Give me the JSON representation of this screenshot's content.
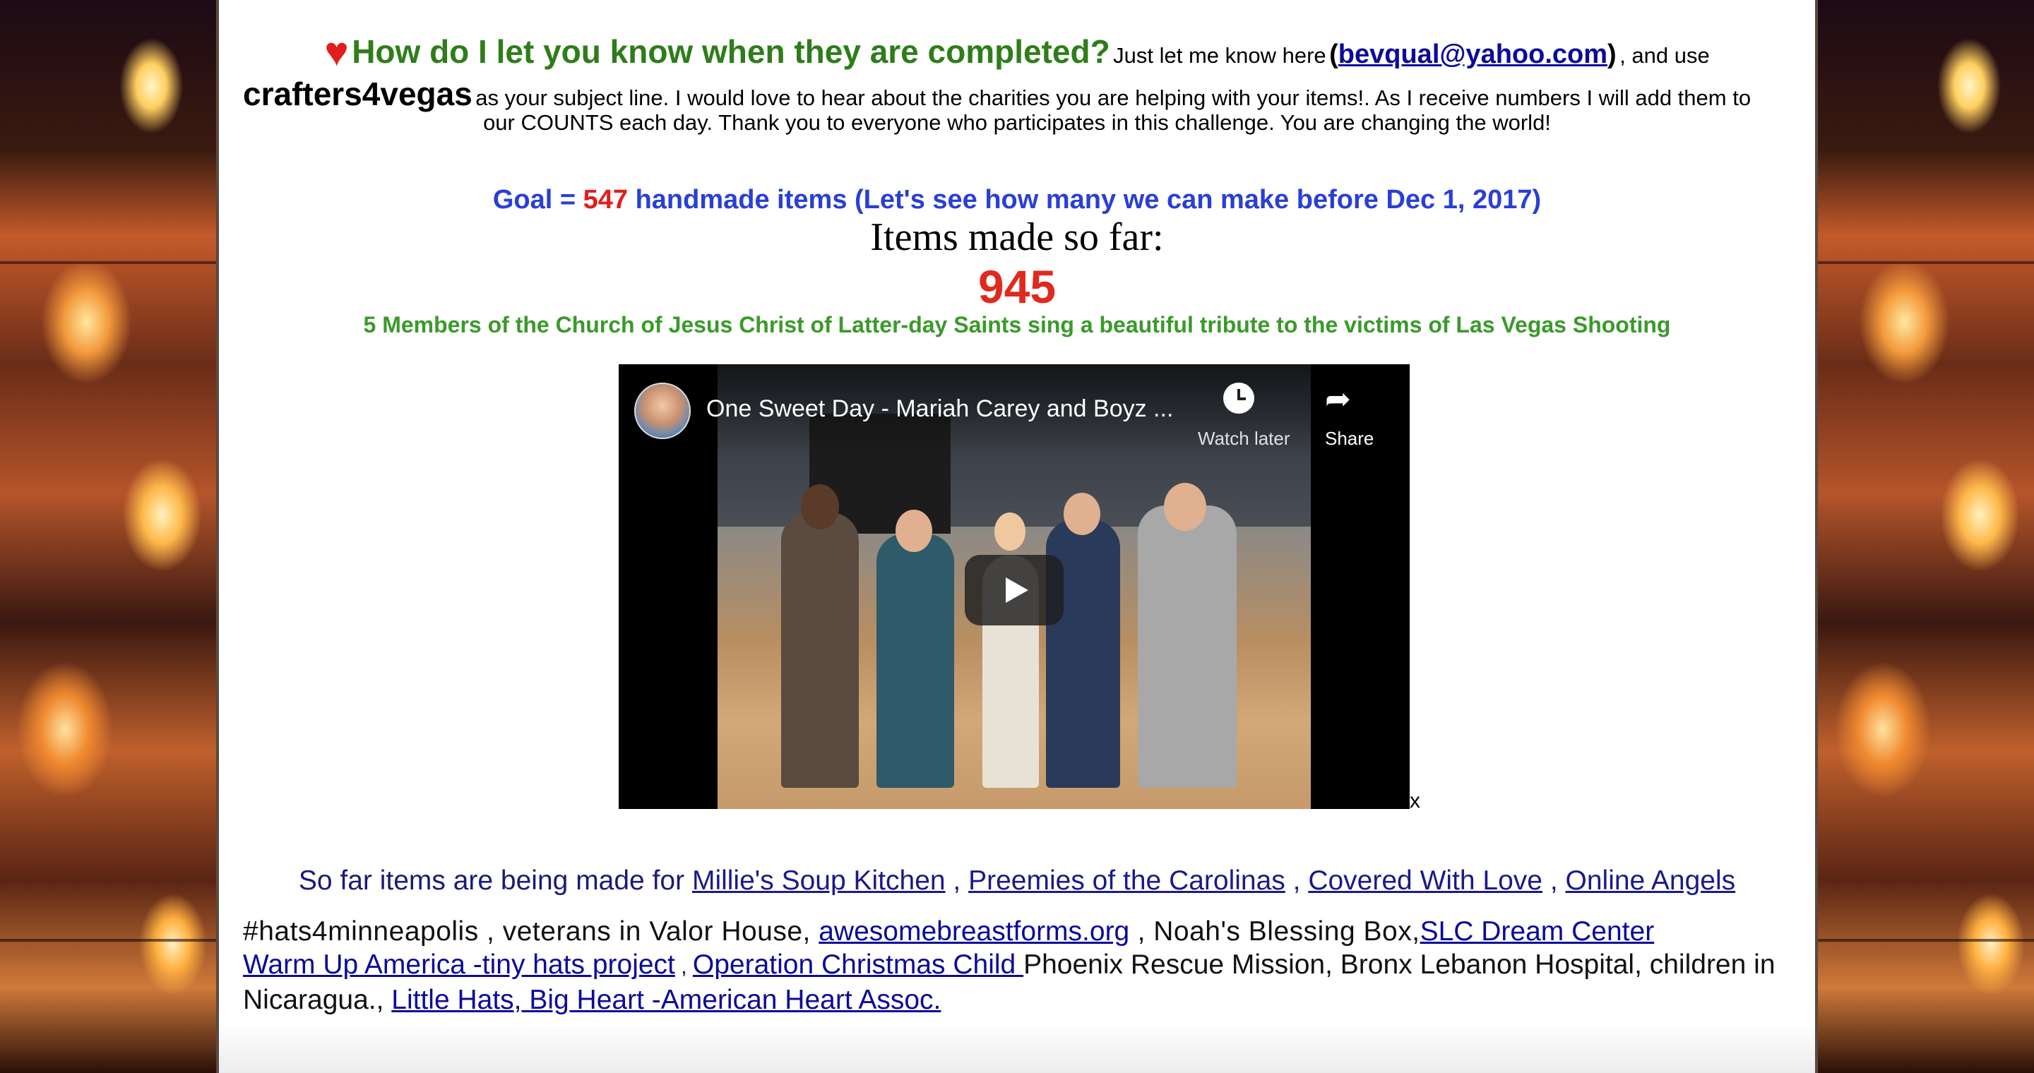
{
  "intro": {
    "heart": "♥",
    "question": "How do I let you know when they are completed?",
    "let_me_know": "Just let me know here",
    "open_paren": "(",
    "email": "bevqual@yahoo.com",
    "close_paren": ")",
    "and_use": ", and use",
    "subject": "crafters4vegas",
    "subject_text": "as your subject line. I would love to hear about the charities you are helping with your items!. As I receive numbers I will add them to",
    "subject_text_2": "our COUNTS each day.  Thank you to everyone who participates in this challenge. You are changing the world!"
  },
  "goal": {
    "prefix": "Goal = ",
    "number": "547",
    "suffix": " handmade items  (Let's see how many we can make before Dec 1, 2017)"
  },
  "count": {
    "label": "Items made so far:",
    "value": "945"
  },
  "members_caption": "5 Members of the Church of Jesus Christ of Latter-day Saints sing a beautiful tribute to the victims of Las Vegas Shooting",
  "video": {
    "title": "One Sweet Day - Mariah Carey and Boyz ...",
    "watch_later": "Watch later",
    "share": "Share"
  },
  "x_mark": "x",
  "charities": {
    "intro": "So far items are being made for",
    "links": [
      "Millie's Soup Kitchen",
      "Preemies of the Carolinas",
      "Covered With Love",
      "Online Angels"
    ],
    "sep": " , "
  },
  "list": {
    "hashtag": "#hats4minneapolis",
    "veterans": " , veterans in Valor House, ",
    "link1": "awesomebreastforms.org",
    "noah": " , Noah's Blessing Box,",
    "link2": "SLC Dream Center ",
    "link3": "Warm Up America -tiny hats project",
    "comma_small": " , ",
    "link4": "Operation Christmas Child ",
    "phoenix": " Phoenix Rescue Mission, Bronx Lebanon Hospital, children in Nicaragua., ",
    "link5": "Little Hats, Big Heart -American Heart Assoc."
  }
}
